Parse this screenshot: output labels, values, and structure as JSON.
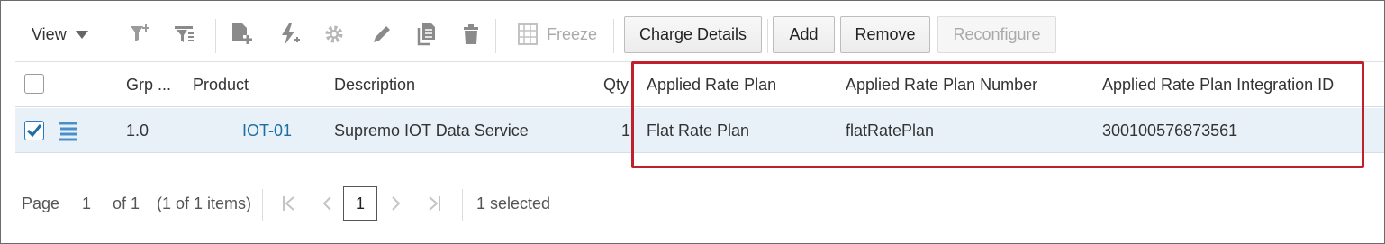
{
  "toolbar": {
    "view_label": "View",
    "freeze_label": "Freeze",
    "charge_details_label": "Charge Details",
    "add_label": "Add",
    "remove_label": "Remove",
    "reconfigure_label": "Reconfigure",
    "icons": [
      "filter-add-icon",
      "filter-options-icon",
      "add-document-icon",
      "flash-icon",
      "gear-icon",
      "pencil-icon",
      "copy-icon",
      "trash-icon",
      "freeze-columns-icon"
    ]
  },
  "table": {
    "columns": [
      "Grp ...",
      "Product",
      "Description",
      "Qty",
      "Applied Rate Plan",
      "Applied Rate Plan Number",
      "Applied Rate Plan Integration ID"
    ],
    "rows": [
      {
        "grp": "1.0",
        "product": "IOT-01",
        "description": "Supremo IOT Data Service",
        "qty": "1",
        "applied_rate_plan": "Flat Rate Plan",
        "applied_rate_plan_number": "flatRatePlan",
        "applied_rate_plan_integration_id": "300100576873561",
        "selected": true
      }
    ]
  },
  "pagination": {
    "page_label": "Page",
    "current_page": "1",
    "of_label": "of 1",
    "items_label": "(1 of 1 items)",
    "page_box": "1",
    "selected_label": "1 selected"
  },
  "colors": {
    "highlight": "#c0202c",
    "selected_row": "#e9f1f8",
    "link": "#1d6ea5",
    "checkbox_accent": "#2b79c2"
  }
}
